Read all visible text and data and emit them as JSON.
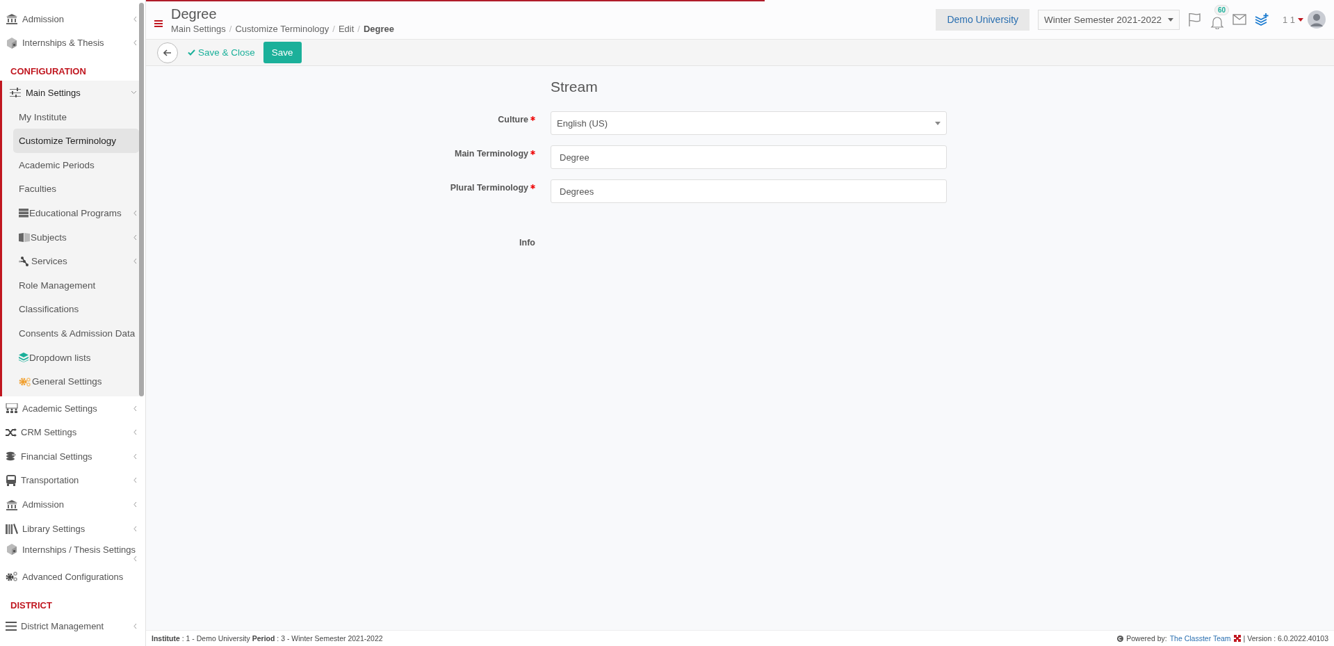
{
  "sidebar": {
    "sections": [
      {
        "items": [
          {
            "label": "Admission",
            "kind": "bank",
            "expandable": true,
            "expanded": false
          },
          {
            "label": "Internships & Thesis",
            "kind": "box",
            "expandable": true,
            "expanded": false
          }
        ]
      },
      {
        "heading": "CONFIGURATION",
        "items": [
          {
            "label": "Main Settings",
            "kind": "sliders",
            "expandable": true,
            "expanded": true,
            "children": [
              {
                "label": "My Institute",
                "kind": "plain",
                "expandable": false,
                "selected": false
              },
              {
                "label": "Customize Terminology",
                "kind": "plain",
                "expandable": false,
                "selected": true
              },
              {
                "label": "Academic Periods",
                "kind": "plain",
                "expandable": false,
                "selected": false
              },
              {
                "label": "Faculties",
                "kind": "plain",
                "expandable": false,
                "selected": false
              },
              {
                "label": "Educational Programs",
                "kind": "server",
                "expandable": true,
                "selected": false
              },
              {
                "label": "Subjects",
                "kind": "book",
                "expandable": true,
                "selected": false
              },
              {
                "label": "Services",
                "kind": "nodes",
                "expandable": true,
                "selected": false
              },
              {
                "label": "Role Management",
                "kind": "plain",
                "expandable": false,
                "selected": false
              },
              {
                "label": "Classifications",
                "kind": "plain",
                "expandable": false,
                "selected": false
              },
              {
                "label": "Consents & Admission Data",
                "kind": "plain",
                "expandable": false,
                "selected": false
              },
              {
                "label": "Dropdown lists",
                "kind": "layers",
                "expandable": false,
                "selected": false
              },
              {
                "label": "General Settings",
                "kind": "cogs",
                "expandable": false,
                "selected": false
              }
            ]
          },
          {
            "label": "Academic Settings",
            "kind": "people",
            "expandable": true,
            "expanded": false
          },
          {
            "label": "CRM Settings",
            "kind": "shuffle",
            "expandable": true,
            "expanded": false
          },
          {
            "label": "Financial Settings",
            "kind": "coins",
            "expandable": true,
            "expanded": false
          },
          {
            "label": "Transportation",
            "kind": "bus",
            "expandable": true,
            "expanded": false
          },
          {
            "label": "Admission",
            "kind": "bank",
            "expandable": true,
            "expanded": false
          },
          {
            "label": "Library Settings",
            "kind": "library",
            "expandable": true,
            "expanded": false
          },
          {
            "label": "Internships / Thesis Settings",
            "kind": "box",
            "expandable": true,
            "expanded": false
          },
          {
            "label": "Advanced Configurations",
            "kind": "gears",
            "expandable": false,
            "expanded": false
          }
        ]
      },
      {
        "heading": "DISTRICT",
        "items": [
          {
            "label": "District Management",
            "kind": "lines",
            "expandable": true,
            "expanded": false
          }
        ]
      }
    ]
  },
  "header": {
    "title": "Degree",
    "breadcrumb": [
      "Main Settings",
      "Customize Terminology",
      "Edit",
      "Degree"
    ],
    "separator": "/",
    "institute": "Demo University",
    "period": "Winter Semester 2021-2022",
    "notifications": "60",
    "user": "1 1"
  },
  "toolbar": {
    "save_close": "Save & Close",
    "save": "Save"
  },
  "form": {
    "title": "Stream",
    "fields": [
      {
        "kind": "select",
        "label": "Culture",
        "required": true,
        "value": "English (US)"
      },
      {
        "kind": "text",
        "label": "Main Terminology",
        "required": true,
        "value": "Degree"
      },
      {
        "kind": "text",
        "label": "Plural Terminology",
        "required": true,
        "value": "Degrees"
      },
      {
        "kind": "info",
        "label": "Info",
        "required": false
      }
    ]
  },
  "footer": {
    "context": "**Institute** : 1 - Demo University **Period** : 3 - Winter Semester 2021-2022",
    "powered_by": "Powered by:",
    "team": "The Classter Team",
    "version": "| Version : 6.0.2022.40103"
  }
}
